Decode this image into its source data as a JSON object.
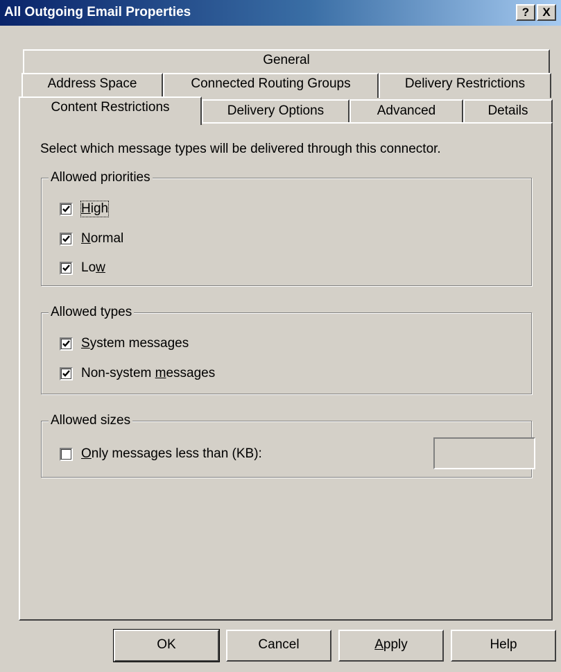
{
  "window": {
    "title": "All Outgoing Email Properties",
    "help_glyph": "?",
    "close_glyph": "X"
  },
  "tabs": {
    "row1": [
      {
        "label": "General"
      }
    ],
    "row2": [
      {
        "label": "Address Space"
      },
      {
        "label": "Connected Routing Groups"
      },
      {
        "label": "Delivery Restrictions"
      }
    ],
    "row3": [
      {
        "label": "Content Restrictions",
        "selected": true
      },
      {
        "label": "Delivery Options"
      },
      {
        "label": "Advanced"
      },
      {
        "label": "Details"
      }
    ]
  },
  "content": {
    "description": "Select which message types will be delivered through this connector.",
    "priorities": {
      "legend": "Allowed priorities",
      "high": {
        "pre": "",
        "key": "H",
        "post": "igh",
        "checked": true
      },
      "normal": {
        "pre": "",
        "key": "N",
        "post": "ormal",
        "checked": true
      },
      "low": {
        "pre": "Lo",
        "key": "w",
        "post": "",
        "checked": true
      }
    },
    "types": {
      "legend": "Allowed types",
      "system": {
        "pre": "",
        "key": "S",
        "post": "ystem messages",
        "checked": true
      },
      "nonsystem": {
        "pre": "Non-system ",
        "key": "m",
        "post": "essages",
        "checked": true
      }
    },
    "sizes": {
      "legend": "Allowed sizes",
      "only_less": {
        "pre": "",
        "key": "O",
        "post": "nly messages less than (KB):",
        "checked": false
      },
      "size_value": ""
    }
  },
  "buttons": {
    "ok": "OK",
    "cancel": "Cancel",
    "apply": {
      "pre": "",
      "key": "A",
      "post": "pply"
    },
    "help": "Help"
  },
  "colors": {
    "titlebar_start": "#0a246a",
    "titlebar_end": "#a6caf0",
    "face": "#d4d0c8"
  }
}
